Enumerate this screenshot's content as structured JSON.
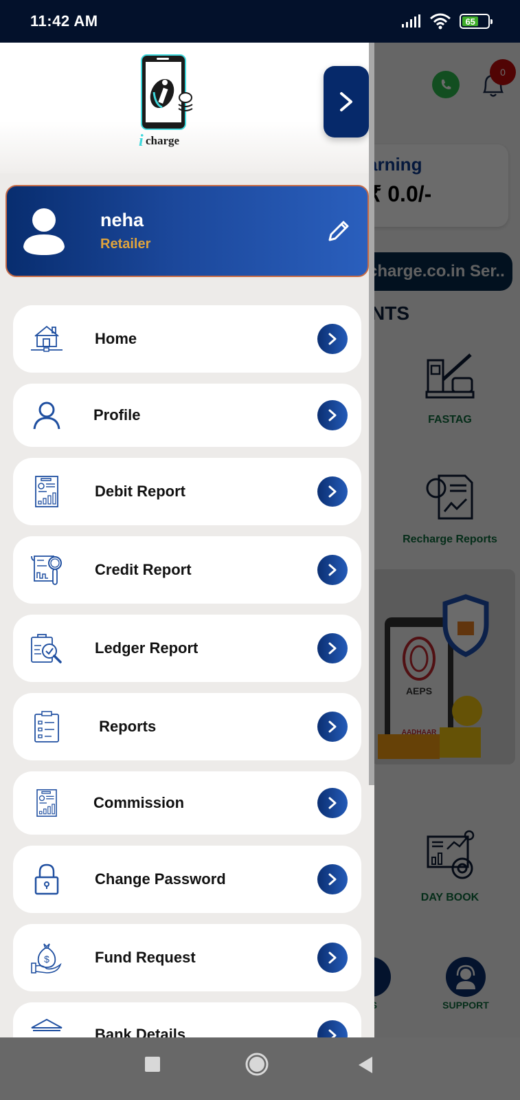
{
  "status_bar": {
    "time": "11:42 AM",
    "battery_level": "65",
    "icons": [
      "signal-icon",
      "wifi-icon",
      "battery-icon"
    ]
  },
  "drawer": {
    "logo_text": "charge",
    "close_button_icon": "chevron-right-icon",
    "profile": {
      "name": "neha",
      "role": "Retailer",
      "edit_icon": "pencil-icon"
    },
    "menu_items": [
      {
        "label": "Home",
        "icon": "home-network-icon"
      },
      {
        "label": "Profile",
        "icon": "user-icon"
      },
      {
        "label": "Debit Report",
        "icon": "report-document-icon"
      },
      {
        "label": "Credit Report",
        "icon": "report-search-icon"
      },
      {
        "label": "Ledger Report",
        "icon": "clipboard-check-icon"
      },
      {
        "label": " Reports",
        "icon": "checklist-icon"
      },
      {
        "label": "Commission",
        "icon": "report-document-icon"
      },
      {
        "label": "Change Password",
        "icon": "lock-icon"
      },
      {
        "label": "Fund Request",
        "icon": "money-bag-hand-icon"
      },
      {
        "label": "Bank Details",
        "icon": "bank-icon"
      }
    ]
  },
  "background_app": {
    "notification_count": "0",
    "earning_title": "arning",
    "earning_amount": "₹ 0.0/-",
    "marquee_text": "charge.co.in Ser..",
    "section_title": "NTS",
    "services": [
      {
        "label": "FASTAG",
        "icon": "toll-gate-icon"
      },
      {
        "label": "Recharge Reports",
        "icon": "chart-report-icon"
      },
      {
        "label": "DAY BOOK",
        "icon": "analytics-dashboard-icon"
      }
    ],
    "banner_text": "AEPS",
    "banner_subtext": "AADHAAR",
    "bottom_nav": [
      {
        "label": "TS",
        "icon": "partial-icon"
      },
      {
        "label": "SUPPORT",
        "icon": "headset-icon"
      }
    ]
  },
  "nav_bar": {
    "buttons": [
      "recents-button",
      "home-button",
      "back-button"
    ]
  },
  "colors": {
    "primary_dark": "#06296a",
    "primary": "#245bb8",
    "accent_role": "#e0a43c",
    "service_label": "#0e6b3d",
    "drawer_bg": "#edebe9"
  }
}
